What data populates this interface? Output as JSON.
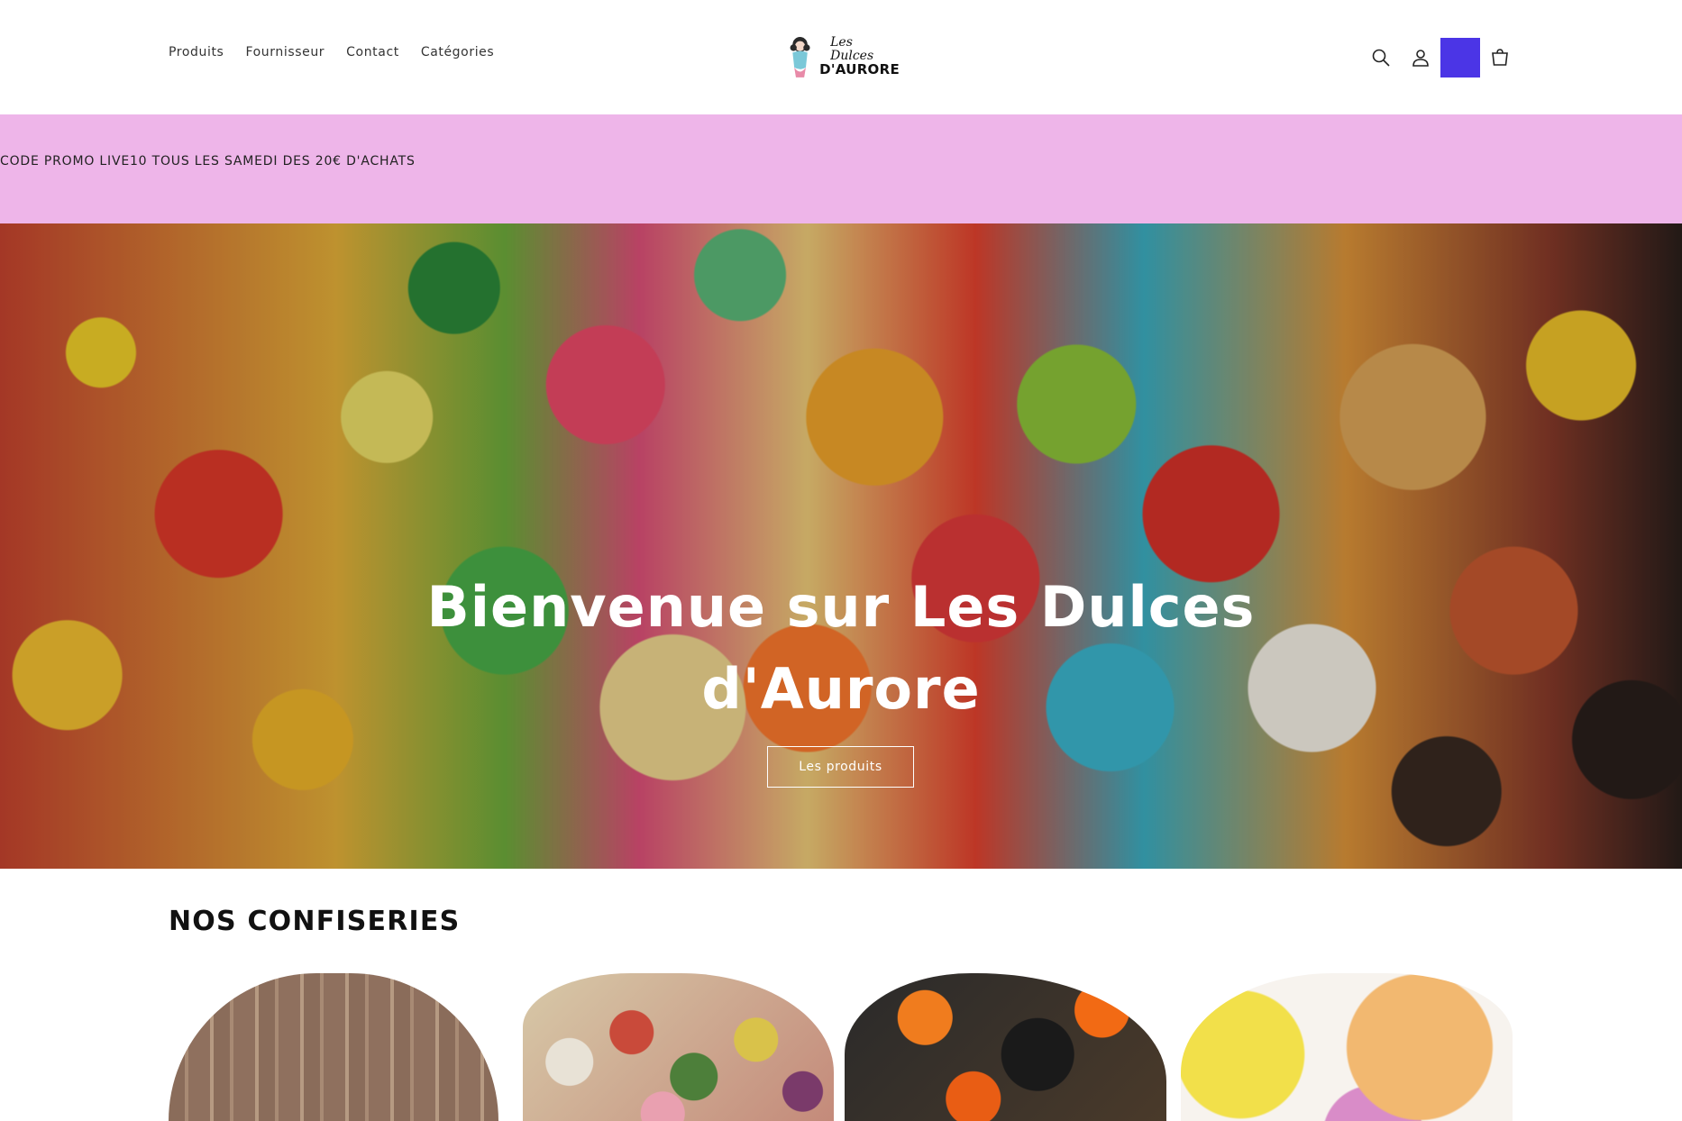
{
  "nav": {
    "items": [
      "Produits",
      "Fournisseur",
      "Contact",
      "Catégories"
    ]
  },
  "logo": {
    "line1": "Les Dulces",
    "line2": "D'AURORE"
  },
  "header_icons": [
    "search-icon",
    "account-icon",
    "cart-icon"
  ],
  "announcement": {
    "text": "CODE PROMO LIVE10 TOUS LES SAMEDI DES 20€ D'ACHATS"
  },
  "hero": {
    "title": "Bienvenue sur Les Dulces d'Aurore",
    "button_label": "Les produits"
  },
  "collections": {
    "title": "NOS CONFISERIES"
  },
  "colors": {
    "announcement_bg": "#eeb5e9",
    "accent_square": "#4b35e6"
  }
}
